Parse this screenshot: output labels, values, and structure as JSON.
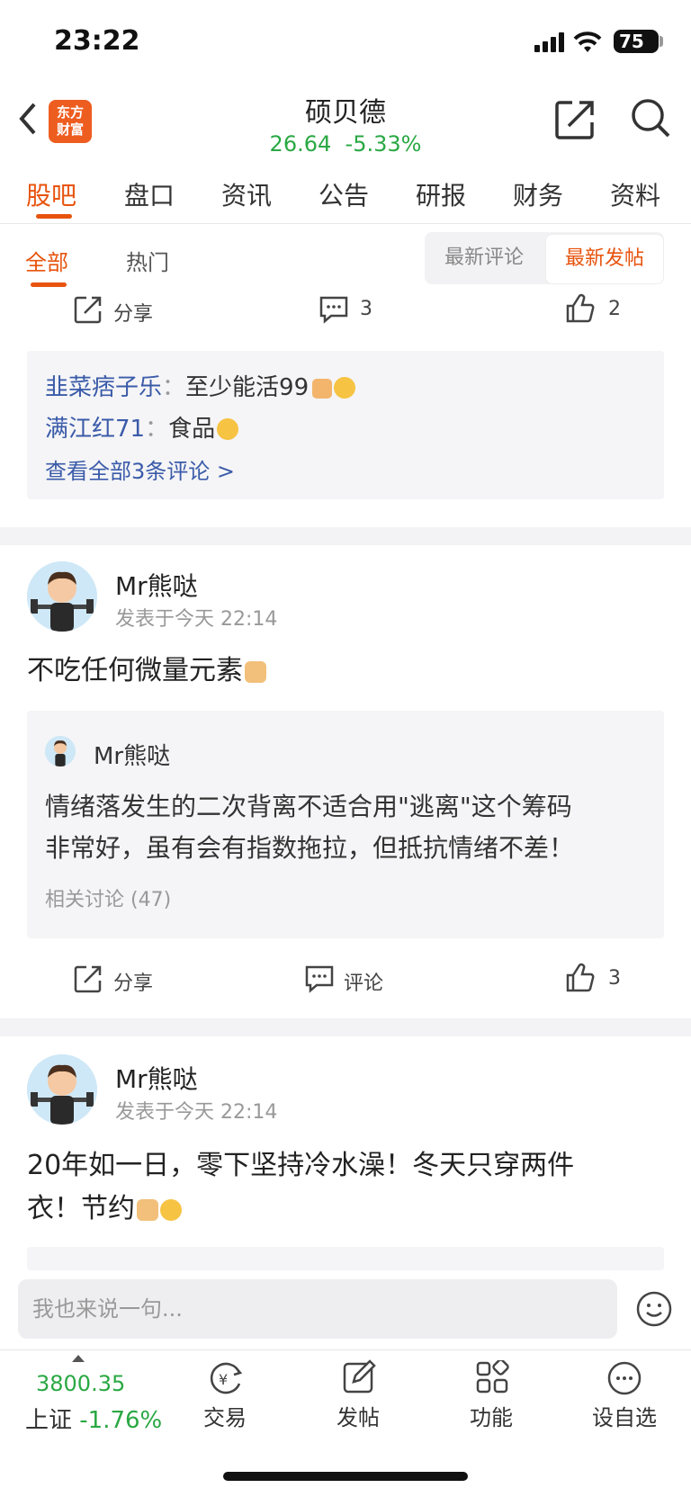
{
  "status_bar": {
    "time": "23:22",
    "battery": "75"
  },
  "header": {
    "logo_line1": "东方",
    "logo_line2": "财富",
    "stock_name": "硕贝德",
    "price": "26.64",
    "change": "-5.33%"
  },
  "tabs": [
    "股吧",
    "盘口",
    "资讯",
    "公告",
    "研报",
    "财务",
    "资料"
  ],
  "filter": {
    "all": "全部",
    "hot": "热门",
    "latest_comment": "最新评论",
    "latest_post": "最新发帖"
  },
  "post0": {
    "share": "分享",
    "comments": "3",
    "likes": "2",
    "replies": [
      {
        "user": "韭菜痞子乐",
        "sep": "：",
        "text": "至少能活99"
      },
      {
        "user": "满江红71",
        "sep": "：",
        "text": "食品"
      }
    ],
    "view_all": "查看全部3条评论 >"
  },
  "post1": {
    "user": "Mr熊哒",
    "time": "发表于今天 22:14",
    "text": "不吃任何微量元素",
    "quote": {
      "user": "Mr熊哒",
      "line1": "情绪落发生的二次背离不适合用\"逃离\"这个筹码",
      "line2": "非常好，虽有会有指数拖拉，但抵抗情绪不差！",
      "related": "相关讨论 (47)"
    },
    "share": "分享",
    "comment": "评论",
    "likes": "3"
  },
  "post2": {
    "user": "Mr熊哒",
    "time": "发表于今天 22:14",
    "line1": "20年如一日，零下坚持冷水澡！冬天只穿两件",
    "line2": "衣！节约"
  },
  "input": {
    "placeholder": "我也来说一句..."
  },
  "bottom_nav": {
    "index_value": "3800.35",
    "index_name": "上证",
    "index_change": "-1.76%",
    "items": [
      "交易",
      "发帖",
      "功能",
      "设自选"
    ]
  }
}
